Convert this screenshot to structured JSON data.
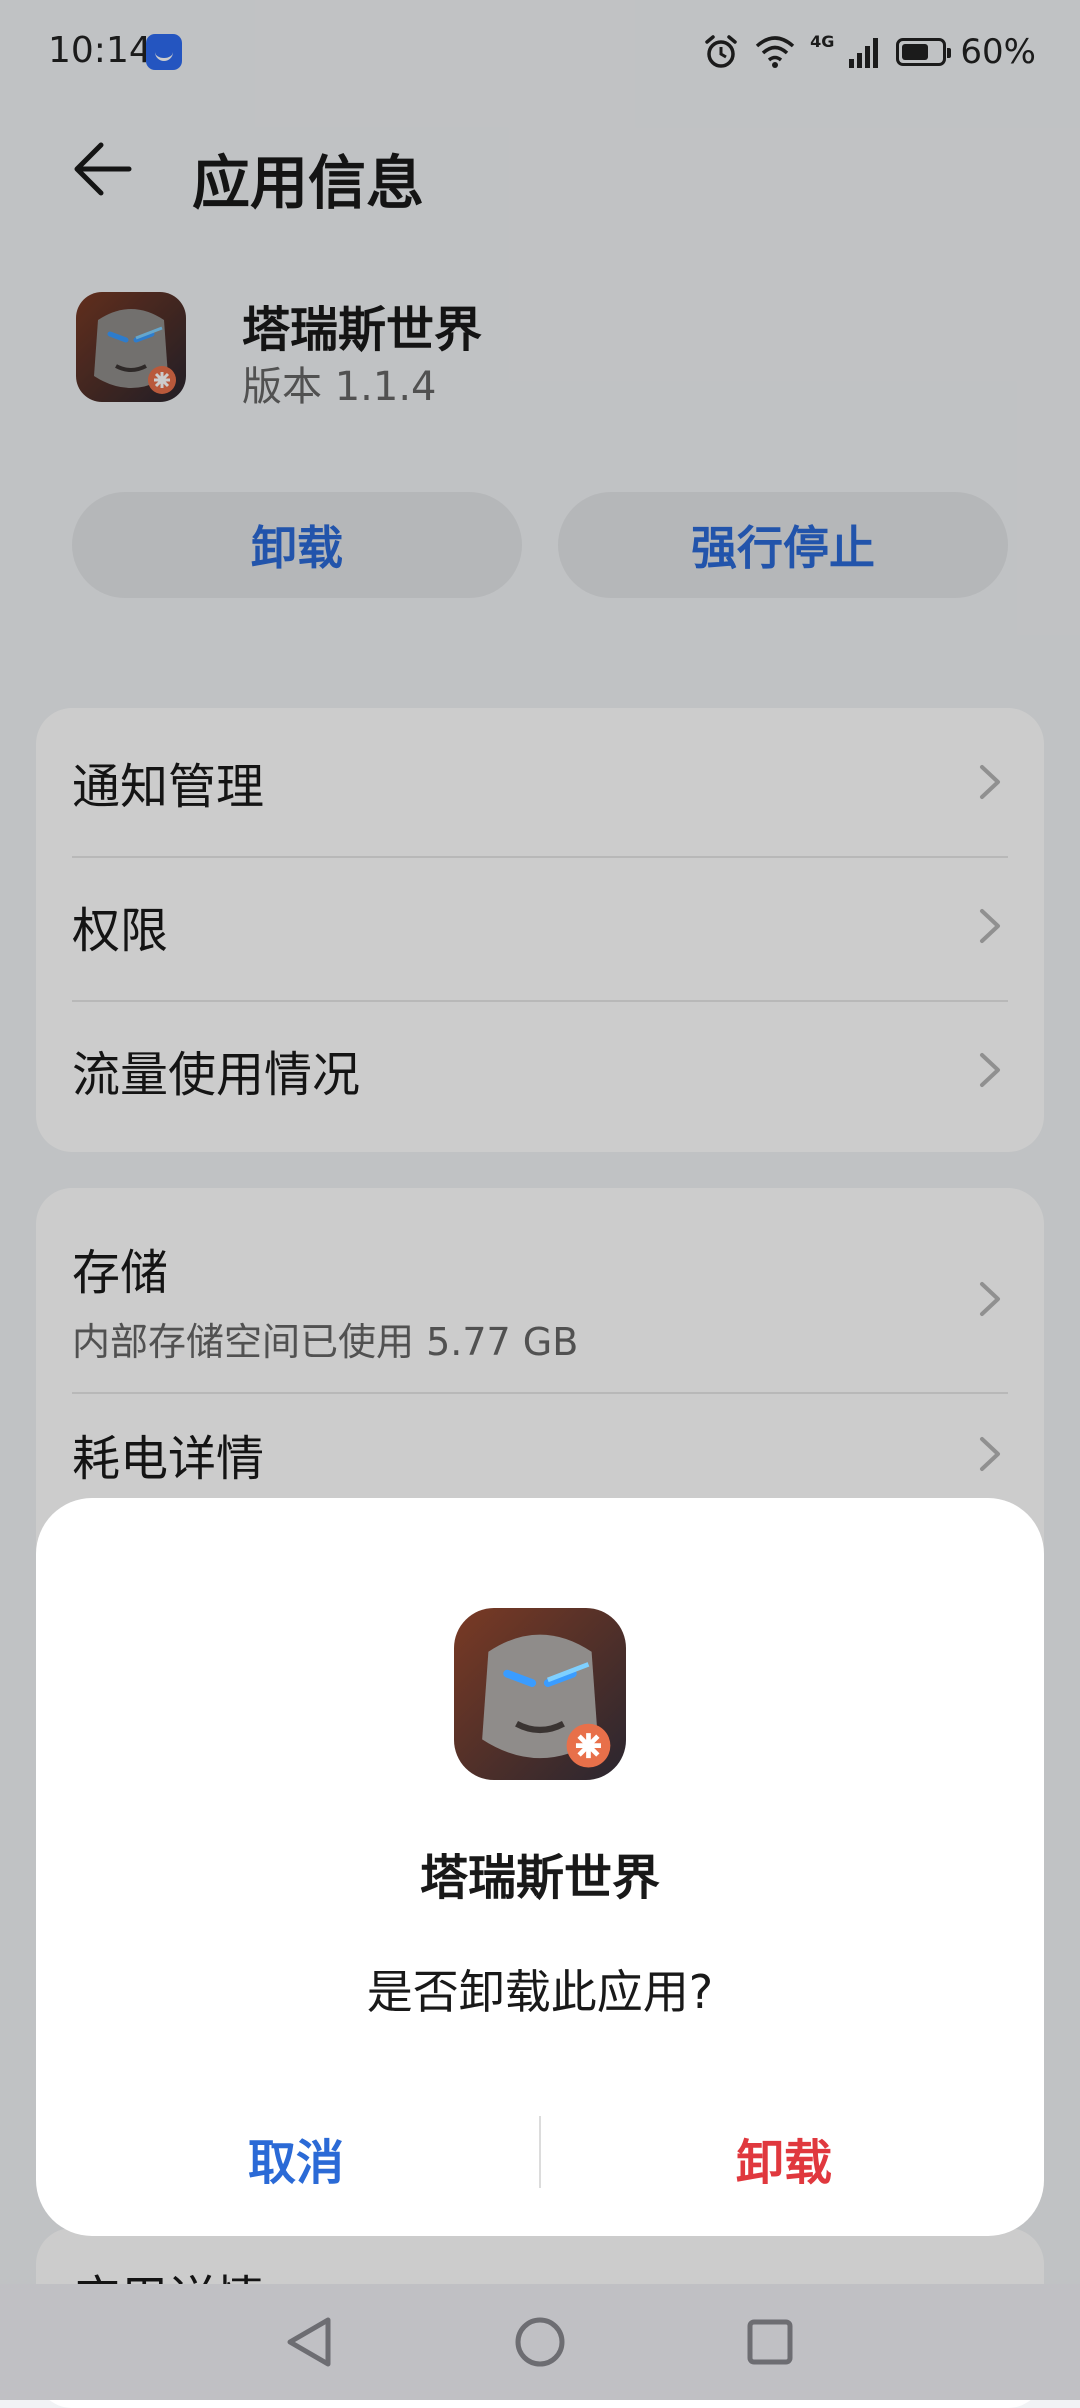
{
  "status_bar": {
    "time": "10:14",
    "network": "4G",
    "battery_percent": "60%"
  },
  "header": {
    "title": "应用信息"
  },
  "app": {
    "name": "塔瑞斯世界",
    "version": "版本 1.1.4"
  },
  "actions": {
    "uninstall_label": "卸载",
    "force_stop_label": "强行停止"
  },
  "settings_group1": [
    {
      "label": "通知管理"
    },
    {
      "label": "权限"
    },
    {
      "label": "流量使用情况"
    }
  ],
  "settings_group2": {
    "storage_label": "存储",
    "storage_detail": "内部存储空间已使用 5.77 GB",
    "battery_label": "耗电详情"
  },
  "settings_group3": {
    "partial_label": "应用详情"
  },
  "dialog": {
    "app_name": "塔瑞斯世界",
    "message": "是否卸载此应用?",
    "cancel_label": "取消",
    "confirm_label": "卸载"
  },
  "colors": {
    "accent": "#2b6ad6",
    "danger": "#e0383e"
  }
}
